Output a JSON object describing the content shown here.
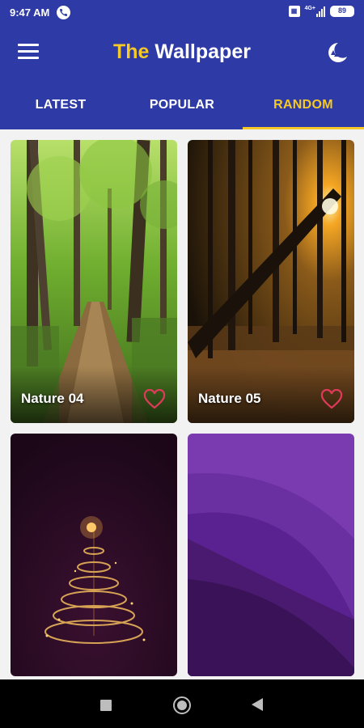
{
  "status_bar": {
    "time": "9:47 AM",
    "network": "4G+",
    "battery": "89"
  },
  "app_bar": {
    "title_accent": "The",
    "title_rest": " Wallpaper"
  },
  "tabs": [
    {
      "label": "LATEST",
      "active": false
    },
    {
      "label": "POPULAR",
      "active": false
    },
    {
      "label": "RANDOM",
      "active": true
    }
  ],
  "wallpapers": [
    {
      "label": "Nature 04",
      "favorite": false
    },
    {
      "label": "Nature 05",
      "favorite": false
    },
    {
      "label": "",
      "favorite": false
    },
    {
      "label": "",
      "favorite": false
    }
  ],
  "colors": {
    "primary": "#2e3aa6",
    "accent": "#f4c928",
    "heart": "#e03a5a"
  },
  "icons": {
    "menu": "menu-icon",
    "theme": "night-mode-icon",
    "favorite": "heart-outline-icon"
  }
}
